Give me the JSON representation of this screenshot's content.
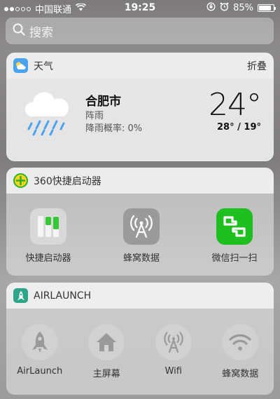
{
  "status_bar": {
    "carrier": "中国联通",
    "time": "19:25",
    "battery": "85%",
    "battery_level": 0.85
  },
  "search": {
    "placeholder": "搜索"
  },
  "weather_widget": {
    "title": "天气",
    "action": "折叠",
    "city": "合肥市",
    "condition": "阵雨",
    "rain_probability": "降雨概率: 0%",
    "temperature": "24°",
    "high_low": "28° / 19°"
  },
  "launcher_360": {
    "title": "360快捷启动器",
    "apps": [
      {
        "label": "快捷启动器",
        "icon": "launcher-sliders-icon"
      },
      {
        "label": "蜂窝数据",
        "icon": "cellular-antenna-icon"
      },
      {
        "label": "微信扫一扫",
        "icon": "wechat-scan-icon"
      }
    ]
  },
  "airlaunch": {
    "title": "AIRLAUNCH",
    "apps": [
      {
        "label": "AirLaunch",
        "icon": "rocket-icon"
      },
      {
        "label": "主屏幕",
        "icon": "home-icon"
      },
      {
        "label": "Wifi",
        "icon": "antenna-icon"
      },
      {
        "label": "蜂窝数据",
        "icon": "wifi-signal-icon"
      }
    ]
  },
  "colors": {
    "weather_icon": "#4aa3f0",
    "launcher_green": "#2ab32a",
    "wechat_green": "#1aad19",
    "airlaunch_teal": "#2fa58a"
  }
}
